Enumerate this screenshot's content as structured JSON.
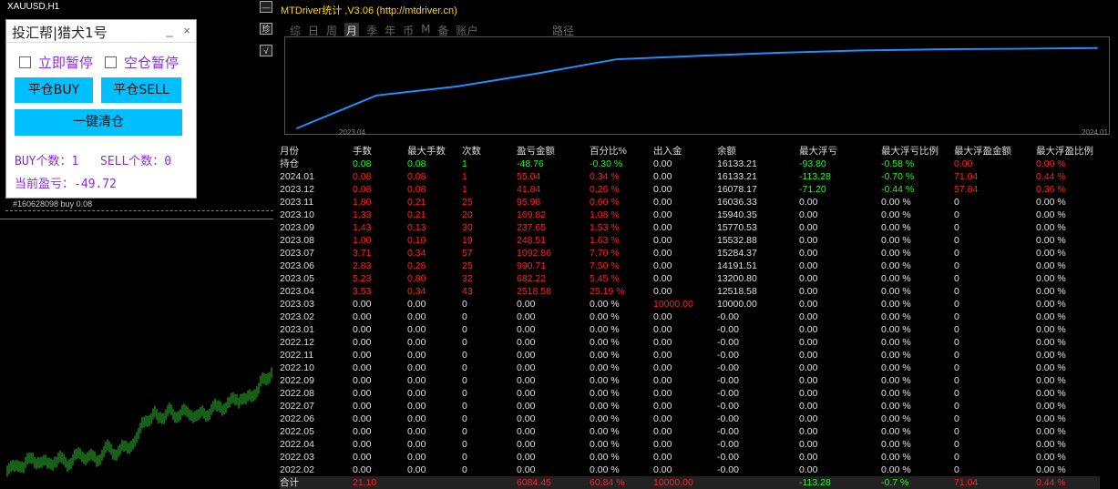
{
  "chart": {
    "symbol": "XAUUSD,H1",
    "button_top": "—",
    "button_mid": "珍",
    "button_low": "√",
    "order_label": "#160628098 buy 0.08"
  },
  "panel": {
    "title": "投汇帮|猎犬1号",
    "min_symbol": "_",
    "close_symbol": "×",
    "pause_now": "立即暂停",
    "pause_empty": "空仓暂停",
    "close_buy": "平仓BUY",
    "close_sell": "平仓SELL",
    "close_all": "一键清仓",
    "buy_count": "BUY个数：1",
    "sell_count": "SELL个数：0",
    "profit": "当前盈亏：-49.72"
  },
  "stats": {
    "title": "MTDriver统计 ,V3.06 (http://mtdriver.cn)",
    "tabs": [
      "综",
      "日",
      "周",
      "月",
      "季",
      "年",
      "币",
      "M",
      "备",
      "账户"
    ],
    "active_tab": "月",
    "path_label": "路径",
    "x_start": "2023.04",
    "x_end": "2024.01",
    "headers": [
      "月份",
      "手数",
      "最大手数",
      "次数",
      "盈亏金额",
      "百分比%",
      "出入金",
      "余额",
      "最大浮亏",
      "最大浮亏比例",
      "最大浮盈金额",
      "最大浮盈比例"
    ],
    "rows": [
      [
        "持仓",
        "0.08",
        "0.08",
        "1",
        "-48.76",
        "-0.30 %",
        "0.00",
        "16133.21",
        "-93.80",
        "-0.58 %",
        "0.00",
        "0.00 %"
      ],
      [
        "2024.01",
        "0.08",
        "0.08",
        "1",
        "55.04",
        "0.34 %",
        "0.00",
        "16133.21",
        "-113.28",
        "-0.70 %",
        "71.04",
        "0.44 %"
      ],
      [
        "2023.12",
        "0.08",
        "0.08",
        "1",
        "41.84",
        "0.26 %",
        "0.00",
        "16078.17",
        "-71.20",
        "-0.44 %",
        "57.84",
        "0.36 %"
      ],
      [
        "2023.11",
        "1.80",
        "0.21",
        "25",
        "95.98",
        "0.60 %",
        "0.00",
        "16036.33",
        "0.00",
        "0.00 %",
        "0",
        "0.00 %"
      ],
      [
        "2023.10",
        "1.33",
        "0.21",
        "20",
        "169.82",
        "1.08 %",
        "0.00",
        "15940.35",
        "0.00",
        "0.00 %",
        "0",
        "0.00 %"
      ],
      [
        "2023.09",
        "1.43",
        "0.13",
        "30",
        "237.65",
        "1.53 %",
        "0.00",
        "15770.53",
        "0.00",
        "0.00 %",
        "0",
        "0.00 %"
      ],
      [
        "2023.08",
        "1.00",
        "0.10",
        "19",
        "248.51",
        "1.63 %",
        "0.00",
        "15532.88",
        "0.00",
        "0.00 %",
        "0",
        "0.00 %"
      ],
      [
        "2023.07",
        "3.71",
        "0.34",
        "57",
        "1092.86",
        "7.70 %",
        "0.00",
        "15284.37",
        "0.00",
        "0.00 %",
        "0",
        "0.00 %"
      ],
      [
        "2023.06",
        "2.83",
        "0.26",
        "25",
        "990.71",
        "7.50 %",
        "0.00",
        "14191.51",
        "0.00",
        "0.00 %",
        "0",
        "0.00 %"
      ],
      [
        "2023.05",
        "5.23",
        "0.80",
        "32",
        "682.22",
        "5.45 %",
        "0.00",
        "13200.80",
        "0.00",
        "0.00 %",
        "0",
        "0.00 %"
      ],
      [
        "2023.04",
        "3.53",
        "0.34",
        "43",
        "2518.58",
        "25.19 %",
        "0.00",
        "12518.58",
        "0.00",
        "0.00 %",
        "0",
        "0.00 %"
      ],
      [
        "2023.03",
        "0.00",
        "0.00",
        "0",
        "0.00",
        "0.00 %",
        "10000.00",
        "10000.00",
        "0.00",
        "0.00 %",
        "0",
        "0.00 %"
      ],
      [
        "2023.02",
        "0.00",
        "0.00",
        "0",
        "0.00",
        "0.00 %",
        "0.00",
        "-0.00",
        "0.00",
        "0.00 %",
        "0",
        "0.00 %"
      ],
      [
        "2023.01",
        "0.00",
        "0.00",
        "0",
        "0.00",
        "0.00 %",
        "0.00",
        "-0.00",
        "0.00",
        "0.00 %",
        "0",
        "0.00 %"
      ],
      [
        "2022.12",
        "0.00",
        "0.00",
        "0",
        "0.00",
        "0.00 %",
        "0.00",
        "-0.00",
        "0.00",
        "0.00 %",
        "0",
        "0.00 %"
      ],
      [
        "2022.11",
        "0.00",
        "0.00",
        "0",
        "0.00",
        "0.00 %",
        "0.00",
        "-0.00",
        "0.00",
        "0.00 %",
        "0",
        "0.00 %"
      ],
      [
        "2022.10",
        "0.00",
        "0.00",
        "0",
        "0.00",
        "0.00 %",
        "0.00",
        "-0.00",
        "0.00",
        "0.00 %",
        "0",
        "0.00 %"
      ],
      [
        "2022.09",
        "0.00",
        "0.00",
        "0",
        "0.00",
        "0.00 %",
        "0.00",
        "-0.00",
        "0.00",
        "0.00 %",
        "0",
        "0.00 %"
      ],
      [
        "2022.08",
        "0.00",
        "0.00",
        "0",
        "0.00",
        "0.00 %",
        "0.00",
        "-0.00",
        "0.00",
        "0.00 %",
        "0",
        "0.00 %"
      ],
      [
        "2022.07",
        "0.00",
        "0.00",
        "0",
        "0.00",
        "0.00 %",
        "0.00",
        "-0.00",
        "0.00",
        "0.00 %",
        "0",
        "0.00 %"
      ],
      [
        "2022.06",
        "0.00",
        "0.00",
        "0",
        "0.00",
        "0.00 %",
        "0.00",
        "-0.00",
        "0.00",
        "0.00 %",
        "0",
        "0.00 %"
      ],
      [
        "2022.05",
        "0.00",
        "0.00",
        "0",
        "0.00",
        "0.00 %",
        "0.00",
        "-0.00",
        "0.00",
        "0.00 %",
        "0",
        "0.00 %"
      ],
      [
        "2022.04",
        "0.00",
        "0.00",
        "0",
        "0.00",
        "0.00 %",
        "0.00",
        "-0.00",
        "0.00",
        "0.00 %",
        "0",
        "0.00 %"
      ],
      [
        "2022.03",
        "0.00",
        "0.00",
        "0",
        "0.00",
        "0.00 %",
        "0.00",
        "-0.00",
        "0.00",
        "0.00 %",
        "0",
        "0.00 %"
      ],
      [
        "2022.02",
        "0.00",
        "0.00",
        "0",
        "0.00",
        "0.00 %",
        "0.00",
        "-0.00",
        "0.00",
        "0.00 %",
        "0",
        "0.00 %"
      ]
    ],
    "total": [
      "合计",
      "21.10",
      "",
      "",
      "6084.45",
      "60.84 %",
      "10000.00",
      "",
      "-113.28",
      "-0.7 %",
      "71.04",
      "0.44 %"
    ]
  },
  "chart_data": {
    "type": "line",
    "x": [
      "2023.04",
      "2023.05",
      "2023.06",
      "2023.07",
      "2023.08",
      "2023.09",
      "2023.10",
      "2023.11",
      "2023.12",
      "2024.01"
    ],
    "values": [
      10000,
      12518.58,
      13200.8,
      14191.51,
      15284.37,
      15532.88,
      15770.53,
      15940.35,
      16036.33,
      16078.17,
      16133.21
    ],
    "color": "#1e90ff"
  },
  "colors": {
    "green": "#1aff1a",
    "red": "#ff2020",
    "accent": "#00bfff",
    "purple": "#8a2be2",
    "title_yellow": "#ffd700"
  }
}
